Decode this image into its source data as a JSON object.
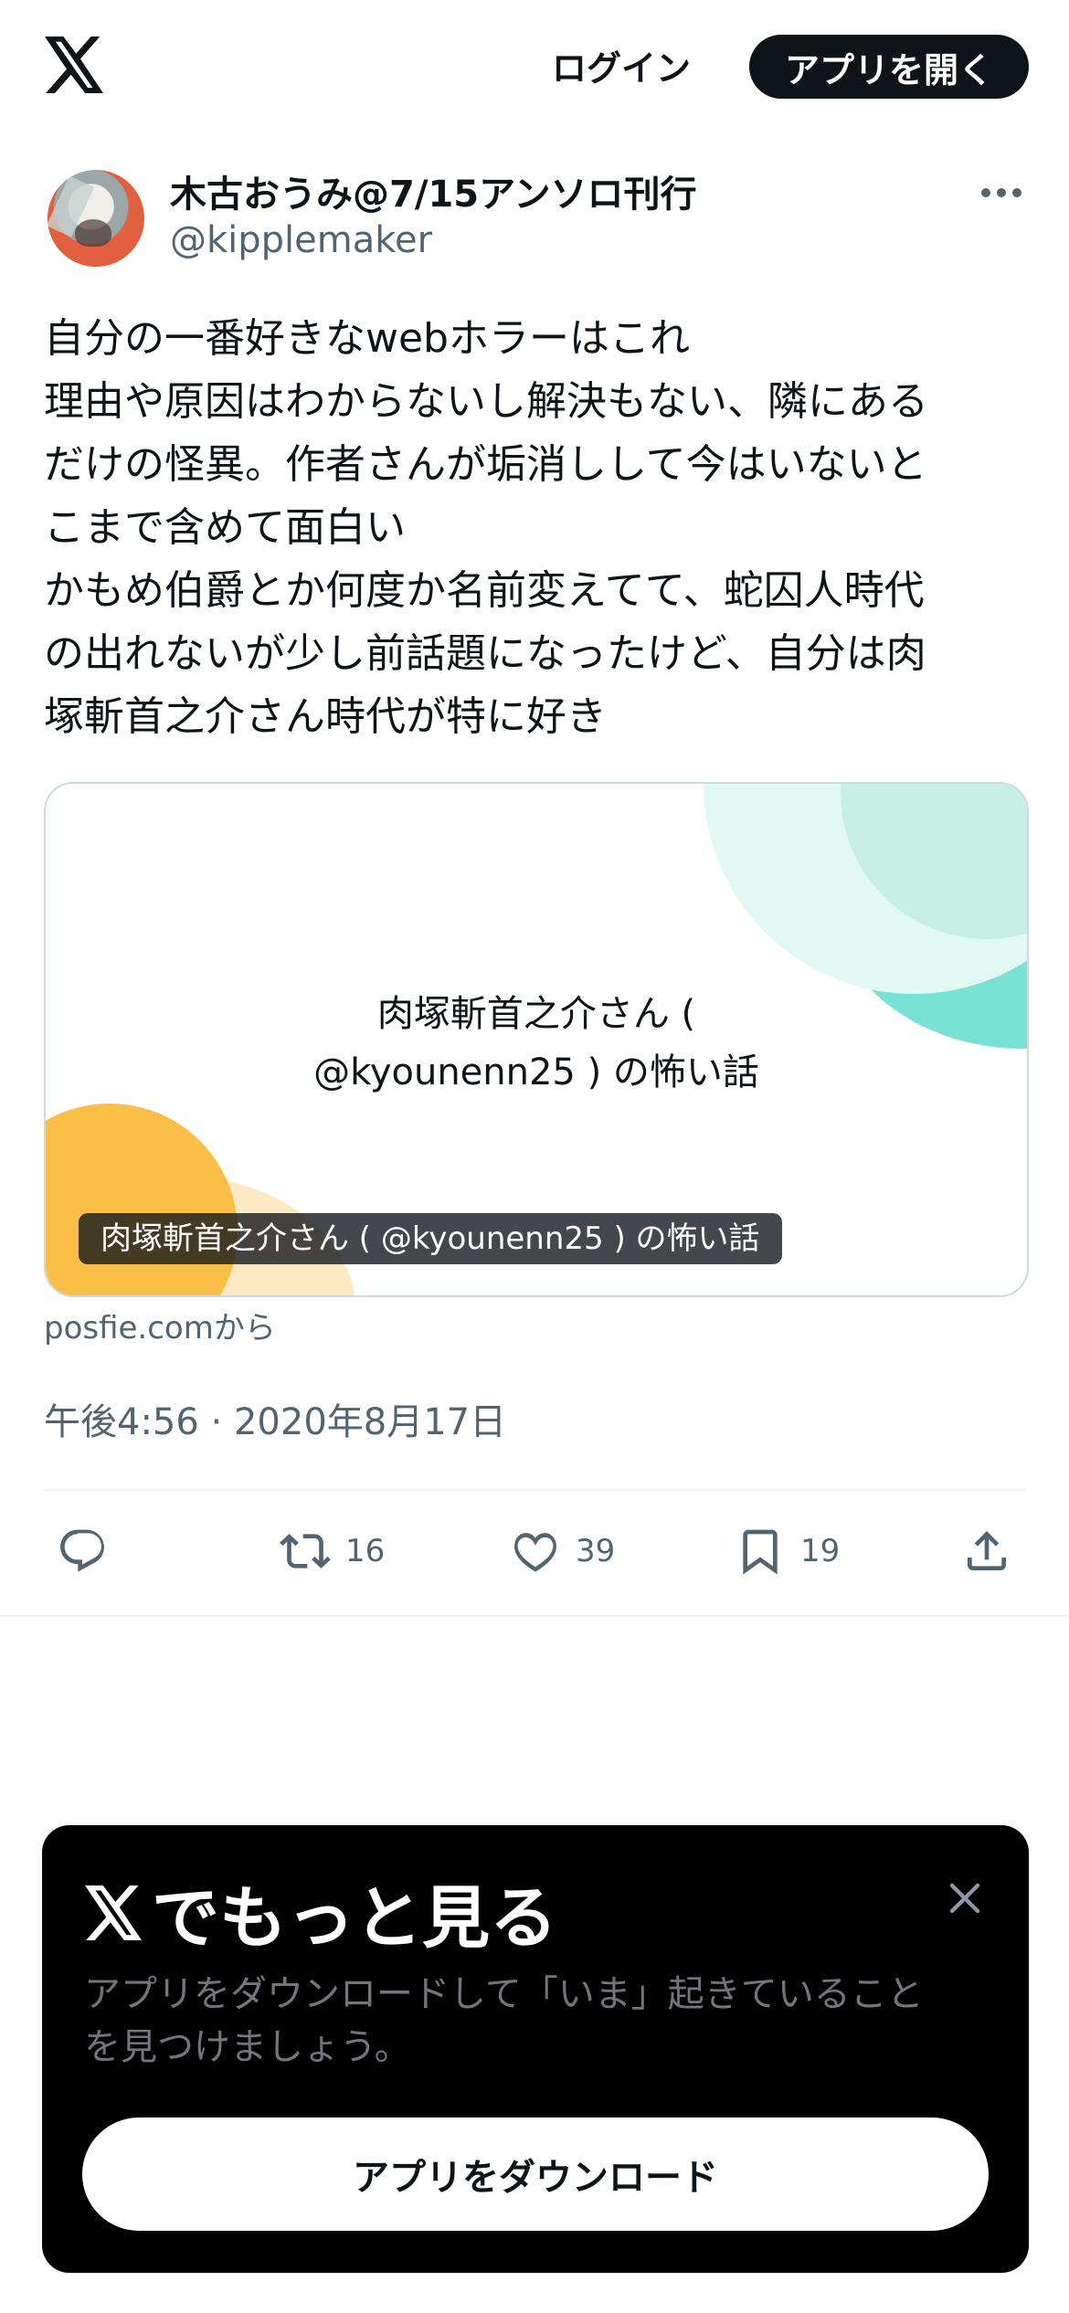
{
  "header": {
    "login_label": "ログイン",
    "open_app_label": "アプリを開く"
  },
  "tweet": {
    "author_name": "木古おうみ@7/15アンソロ刊行",
    "author_handle": "@kipplemaker",
    "text": "自分の一番好きなwebホラーはこれ\n理由や原因はわからないし解決もない、隣にある\nだけの怪異。作者さんが垢消しして今はいないと\nこまで含めて面白い\nかもめ伯爵とか何度か名前変えてて、蛇囚人時代\nの出れないが少し前話題になったけど、自分は肉\n塚斬首之介さん時代が特に好き",
    "card": {
      "title_line1": "肉塚斬首之介さん (",
      "title_line2": "@kyounenn25 ) の怖い話",
      "caption": "肉塚斬首之介さん ( @kyounenn25 ) の怖い話",
      "source": "posfie.comから"
    },
    "timestamp": "午後4:56 · 2020年8月17日",
    "actions": {
      "retweets": "16",
      "likes": "39",
      "bookmarks": "19"
    }
  },
  "sheet": {
    "title": "でもっと見る",
    "description": "アプリをダウンロードして「いま」起きていること\nを見つけましょう。",
    "download_label": "アプリをダウンロード"
  },
  "colors": {
    "text": "#0f1419",
    "secondary": "#536471",
    "border": "#cfd9de",
    "sheet_bg": "#000000"
  }
}
